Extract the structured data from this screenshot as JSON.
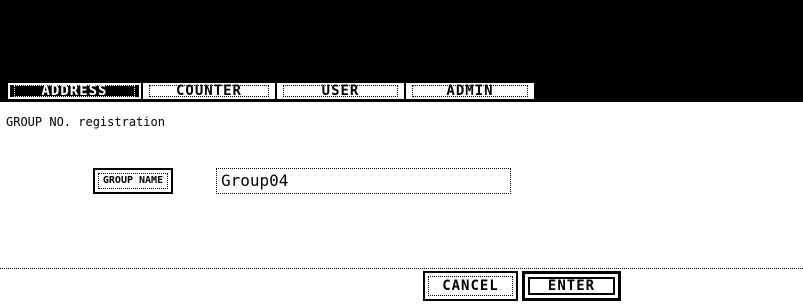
{
  "tabs": {
    "address": "ADDRESS",
    "counter": "COUNTER",
    "user": "USER",
    "admin": "ADMIN",
    "active": "ADDRESS"
  },
  "page": {
    "title": "GROUP NO. registration"
  },
  "form": {
    "group_name_button": "GROUP NAME",
    "group_name_value": "Group04"
  },
  "buttons": {
    "cancel": "CANCEL",
    "enter": "ENTER"
  },
  "colors": {
    "header_background": "#000000",
    "content_background": "#ffffff",
    "text": "#000000"
  }
}
